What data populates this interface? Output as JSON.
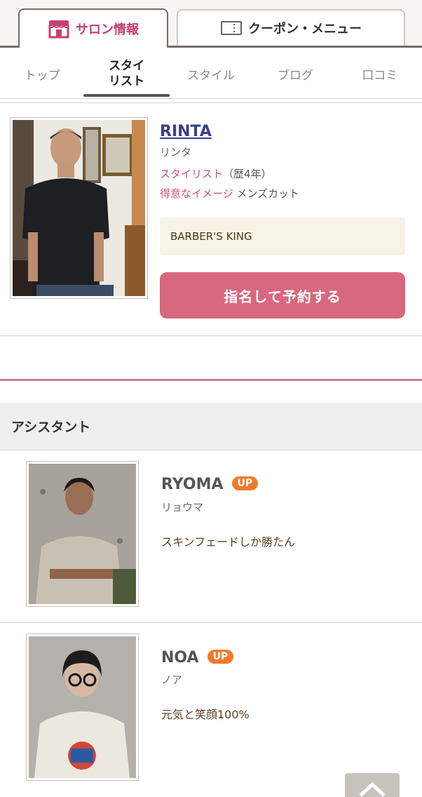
{
  "top_tabs": [
    {
      "label": "サロン情報",
      "icon": "shop-icon",
      "active": true
    },
    {
      "label": "クーポン・メニュー",
      "icon": "coupon-icon",
      "active": false
    }
  ],
  "subnav": [
    {
      "label": "トップ"
    },
    {
      "label": "スタイ\nリスト",
      "active": true
    },
    {
      "label": "スタイル"
    },
    {
      "label": "ブログ"
    },
    {
      "label": "口コミ"
    }
  ],
  "stylist": {
    "name": "RINTA",
    "kana": "リンタ",
    "role_label": "スタイリスト",
    "years": "（歴4年）",
    "image_label": "得意なイメージ",
    "image_value": "メンズカット",
    "salon": "BARBER'S KING",
    "reserve_label": "指名して予約する"
  },
  "assistant_section": {
    "title": "アシスタント"
  },
  "assistants": [
    {
      "name": "RYOMA",
      "badge": "UP",
      "kana": "リョウマ",
      "comment": "スキンフェードしか勝たん"
    },
    {
      "name": "NOA",
      "badge": "UP",
      "kana": "ノア",
      "comment": "元気と笑顔100%"
    }
  ],
  "colors": {
    "accent_pink": "#d24f7c",
    "button_pink": "#d8687f",
    "badge_orange": "#f07a2c",
    "link_blue": "#3a3f8a"
  }
}
